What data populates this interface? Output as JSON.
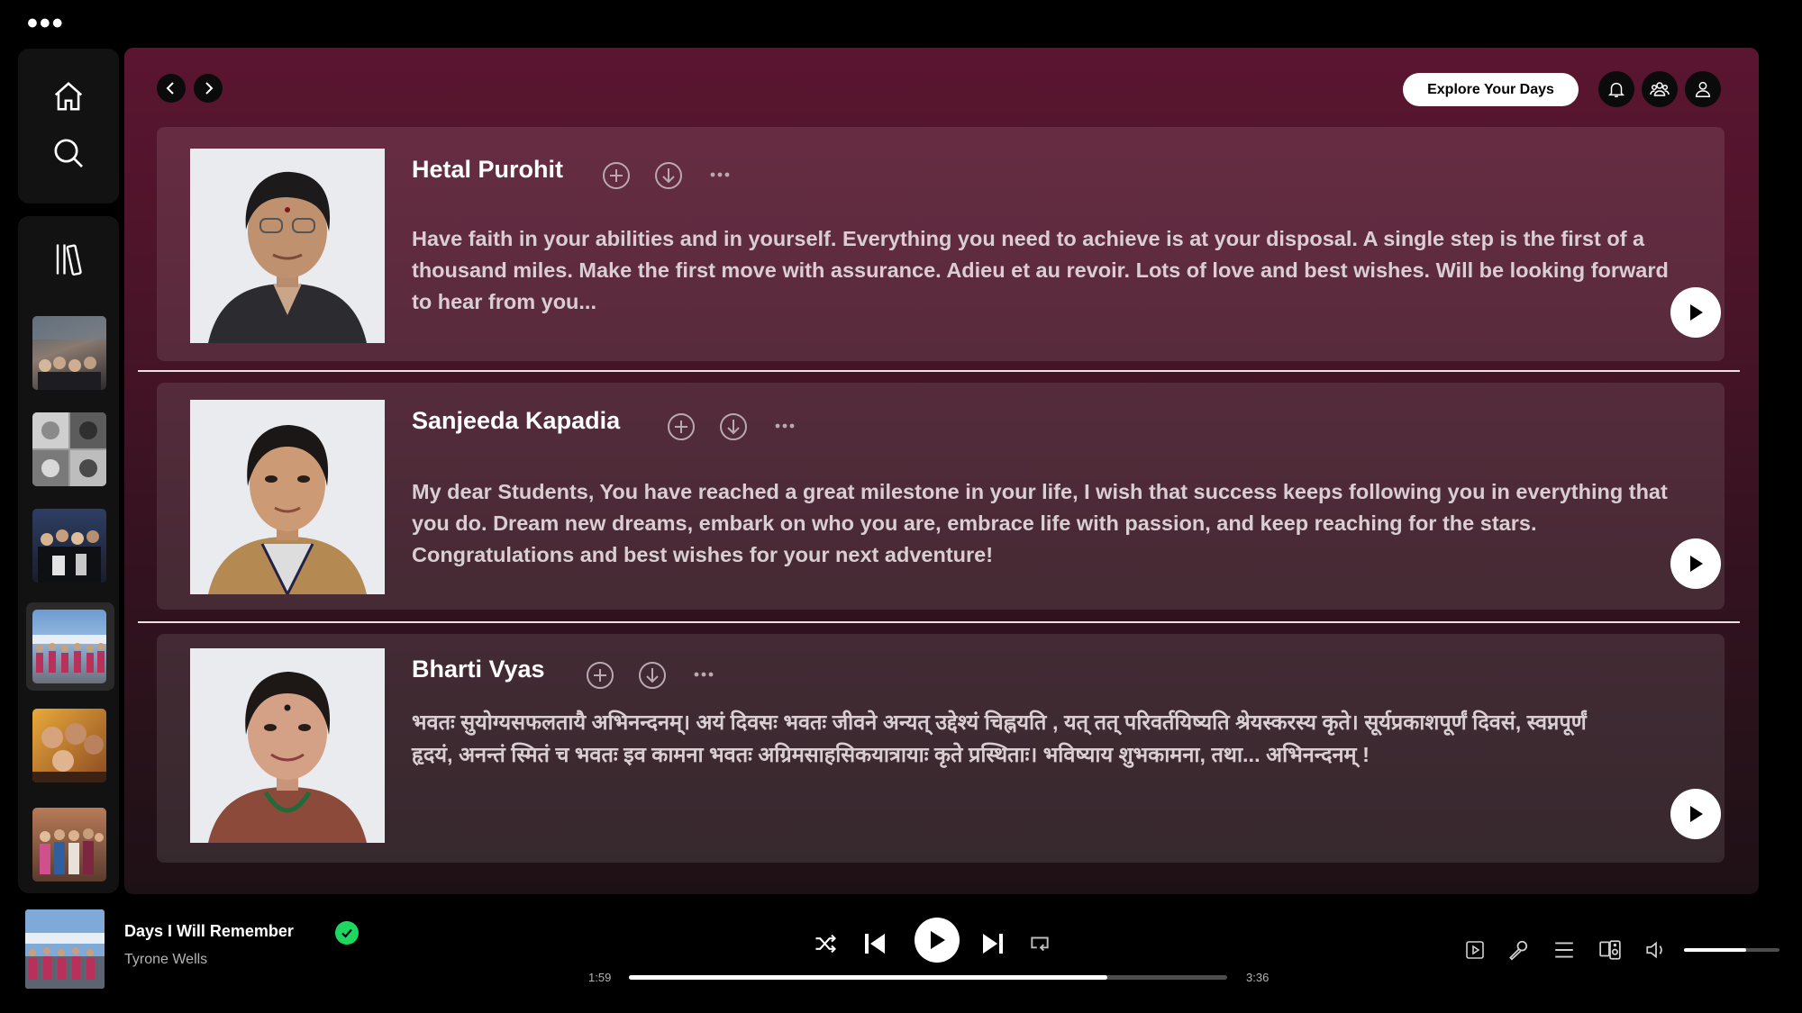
{
  "window": {
    "menu_icon": "more-dots-icon"
  },
  "sidebar": {
    "home_icon": "home-icon",
    "search_icon": "search-icon",
    "library_icon": "library-icon",
    "items": [
      {
        "name": "group-photo-1"
      },
      {
        "name": "portrait-collage"
      },
      {
        "name": "group-photo-2"
      },
      {
        "name": "group-photo-3",
        "selected": true
      },
      {
        "name": "friends-selfie"
      },
      {
        "name": "friends-group"
      }
    ]
  },
  "header": {
    "explore_label": "Explore Your Days",
    "icons": [
      "bell-icon",
      "friends-icon",
      "user-icon"
    ]
  },
  "cards": [
    {
      "name": "Hetal Purohit",
      "message": "Have faith in your abilities and in yourself. Everything you need to achieve is at your disposal. A single step is the first of a thousand miles. Make the first move with assurance. Adieu et au revoir. Lots of love and best wishes. Will be looking forward to hear from you..."
    },
    {
      "name": "Sanjeeda Kapadia",
      "message": "My dear Students, You have reached a great milestone in your life, I wish that success keeps following you in everything that you do. Dream new dreams, embark on who you are, embrace life with passion, and keep reaching for the stars. Congratulations and best wishes for your next adventure!"
    },
    {
      "name": "Bharti Vyas",
      "message": "भवतः सुयोग्यसफलतायै अभिनन्दनम्। अयं दिवसः भवतः जीवने अन्यत् उद्देश्यं चिह्नयति , यत् तत् परिवर्तयिष्यति श्रेयस्करस्य कृते। सूर्यप्रकाशपूर्णं दिवसं, स्वप्नपूर्णं हृदयं, अनन्तं स्मितं च भवतः इव कामना भवतः अग्रिमसाहसिकयात्रायाः कृते प्रस्थिताः। भविष्याय शुभकामना, तथा... अभिनन्दनम् !"
    }
  ],
  "player": {
    "title": "Days I Will Remember",
    "artist": "Tyrone Wells",
    "elapsed": "1:59",
    "duration": "3:36",
    "progress": 0.8,
    "volume": 0.65,
    "controls": [
      "shuffle-icon",
      "previous-icon",
      "play-icon",
      "next-icon",
      "repeat-icon"
    ],
    "right_icons": [
      "now-playing-view-icon",
      "lyrics-icon",
      "queue-icon",
      "connect-device-icon",
      "volume-icon"
    ]
  },
  "colors": {
    "accent": "#1ed760",
    "panel_top": "#5b1530",
    "panel_bottom": "#1e1116"
  }
}
